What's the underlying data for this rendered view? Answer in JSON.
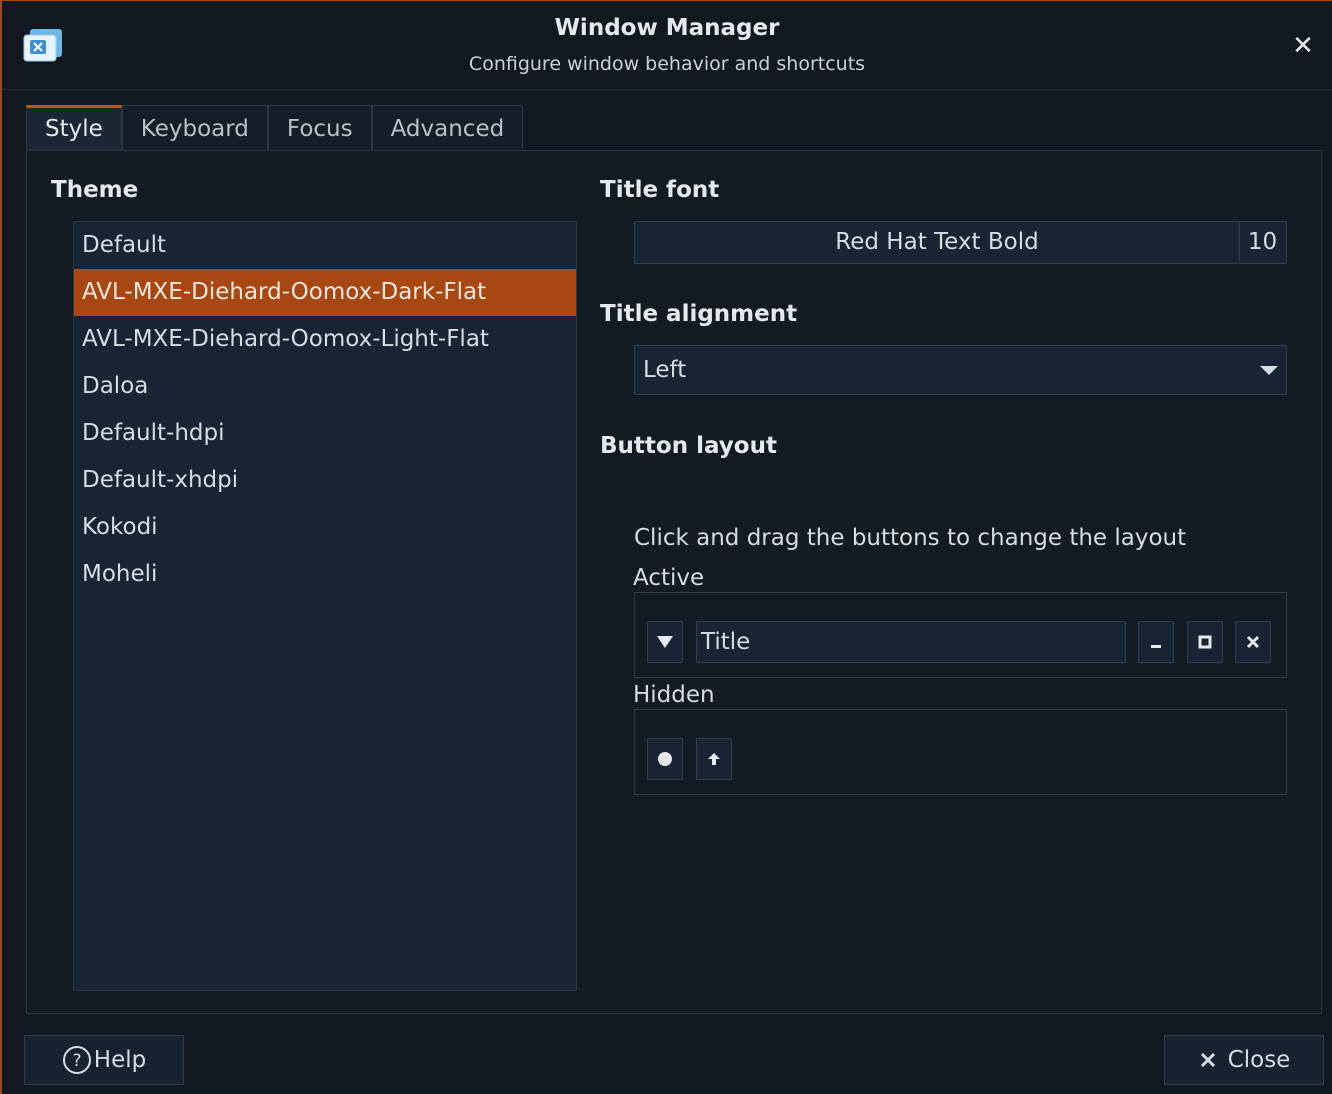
{
  "window": {
    "title": "Window Manager",
    "subtitle": "Configure window behavior and shortcuts",
    "close_glyph": "✕"
  },
  "tabs": [
    {
      "label": "Style",
      "active": true
    },
    {
      "label": "Keyboard",
      "active": false
    },
    {
      "label": "Focus",
      "active": false
    },
    {
      "label": "Advanced",
      "active": false
    }
  ],
  "style": {
    "theme_heading": "Theme",
    "themes": [
      {
        "name": "Default",
        "selected": false
      },
      {
        "name": "AVL-MXE-Diehard-Oomox-Dark-Flat",
        "selected": true
      },
      {
        "name": "AVL-MXE-Diehard-Oomox-Light-Flat",
        "selected": false
      },
      {
        "name": "Daloa",
        "selected": false
      },
      {
        "name": "Default-hdpi",
        "selected": false
      },
      {
        "name": "Default-xhdpi",
        "selected": false
      },
      {
        "name": "Kokodi",
        "selected": false
      },
      {
        "name": "Moheli",
        "selected": false
      }
    ],
    "title_font_heading": "Title font",
    "title_font_name": "Red Hat Text Bold",
    "title_font_size": "10",
    "title_alignment_heading": "Title alignment",
    "title_alignment_value": "Left",
    "button_layout_heading": "Button layout",
    "button_layout_hint": "Click and drag the buttons to change the layout",
    "active_label": "Active",
    "title_slot_label": "Title",
    "active_buttons": [
      "menu-icon",
      "minimize-icon",
      "maximize-icon",
      "close-icon"
    ],
    "hidden_label": "Hidden",
    "hidden_buttons": [
      "stick-icon",
      "shade-icon"
    ]
  },
  "footer": {
    "help_label": "Help",
    "close_label": "Close"
  },
  "colors": {
    "accent": "#a74812",
    "background": "#121a23",
    "list_bg": "#172434"
  }
}
